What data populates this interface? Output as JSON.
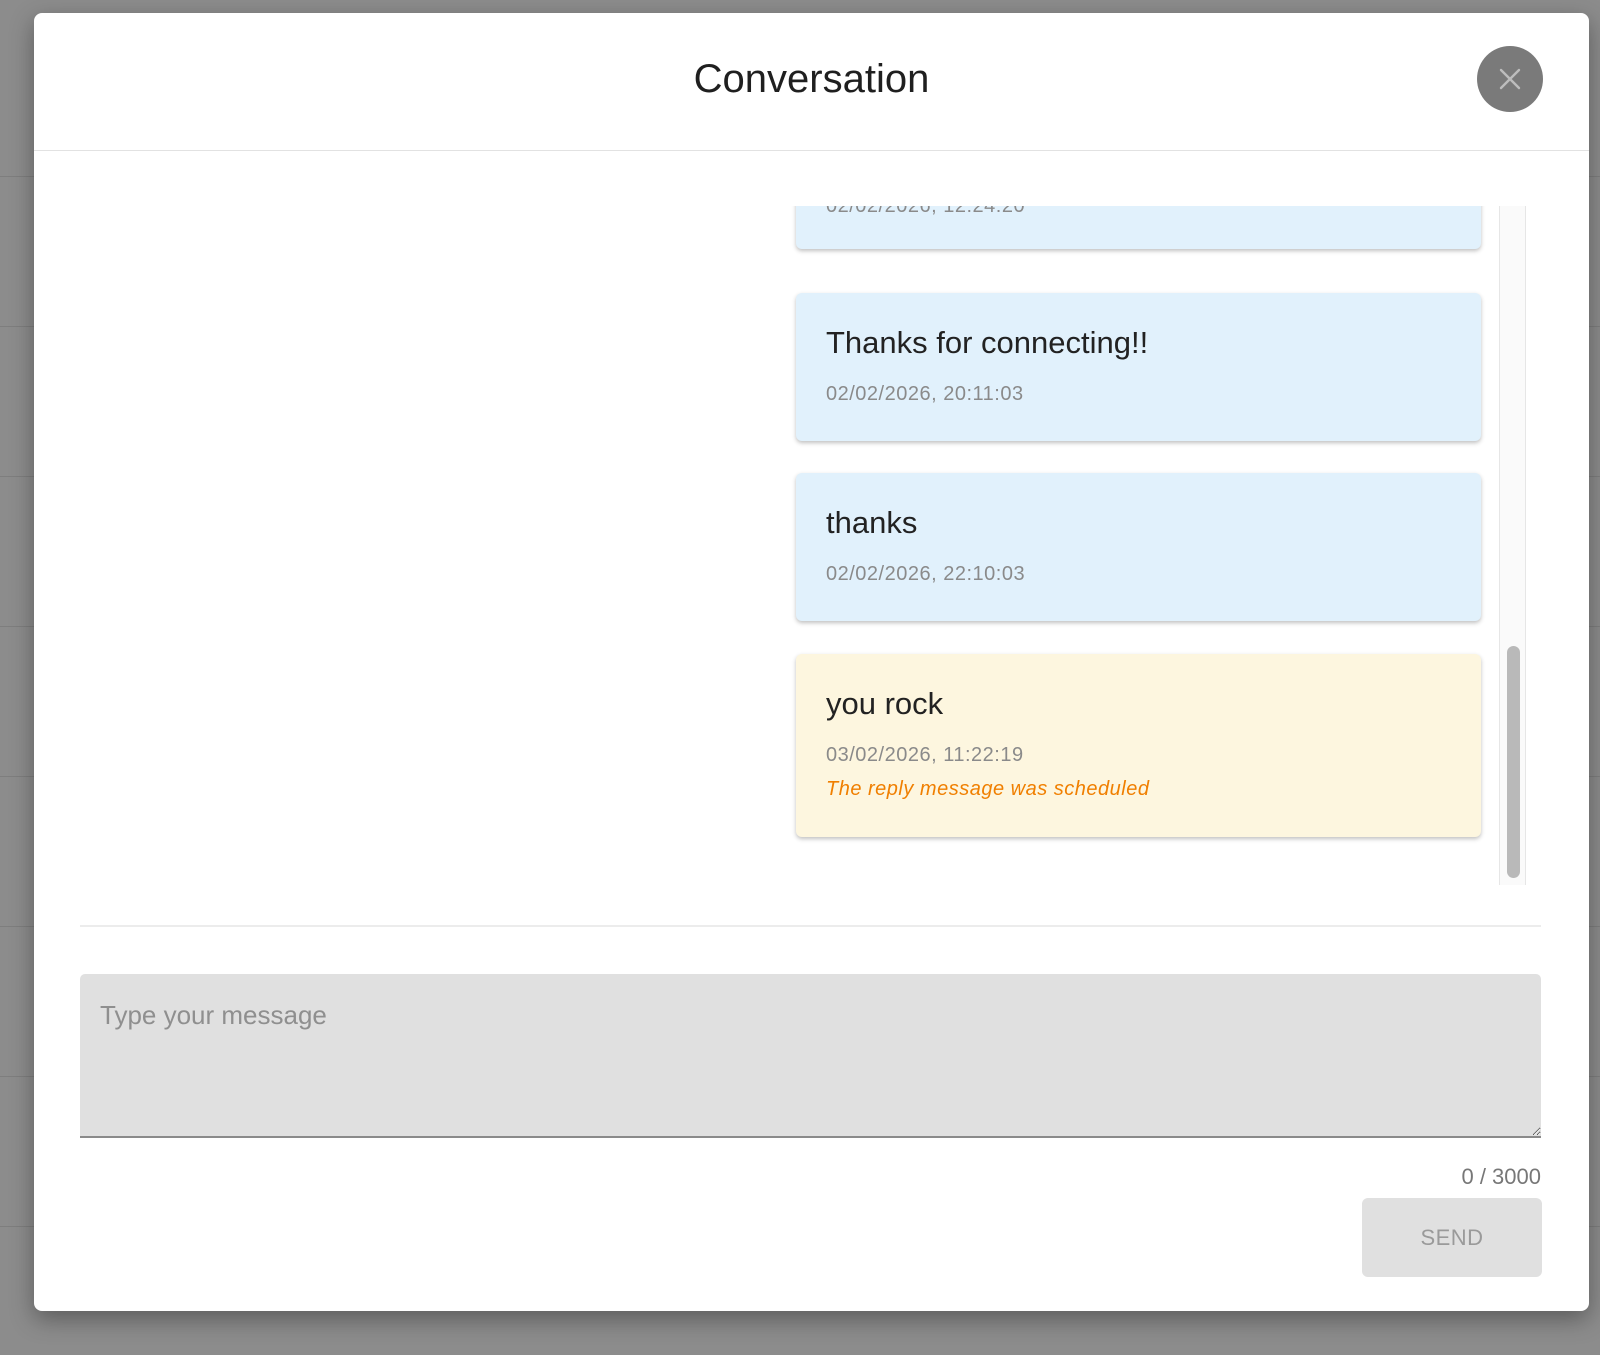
{
  "modal": {
    "title": "Conversation",
    "close_icon": "close-icon"
  },
  "messages": [
    {
      "text": "",
      "time": "02/02/2026, 12:24:20",
      "type": "incoming"
    },
    {
      "text": "Thanks for connecting!!",
      "time": "02/02/2026, 20:11:03",
      "type": "incoming"
    },
    {
      "text": "thanks",
      "time": "02/02/2026, 22:10:03",
      "type": "incoming"
    },
    {
      "text": "you rock",
      "time": "03/02/2026, 11:22:19",
      "type": "outgoing",
      "note": "The reply message was scheduled"
    }
  ],
  "composer": {
    "placeholder": "Type your message",
    "counter": "0 / 3000",
    "send_label": "SEND"
  },
  "colors": {
    "incoming_bg": "#e1f1fc",
    "outgoing_bg": "#fdf6df",
    "note_color": "#f07f00"
  }
}
